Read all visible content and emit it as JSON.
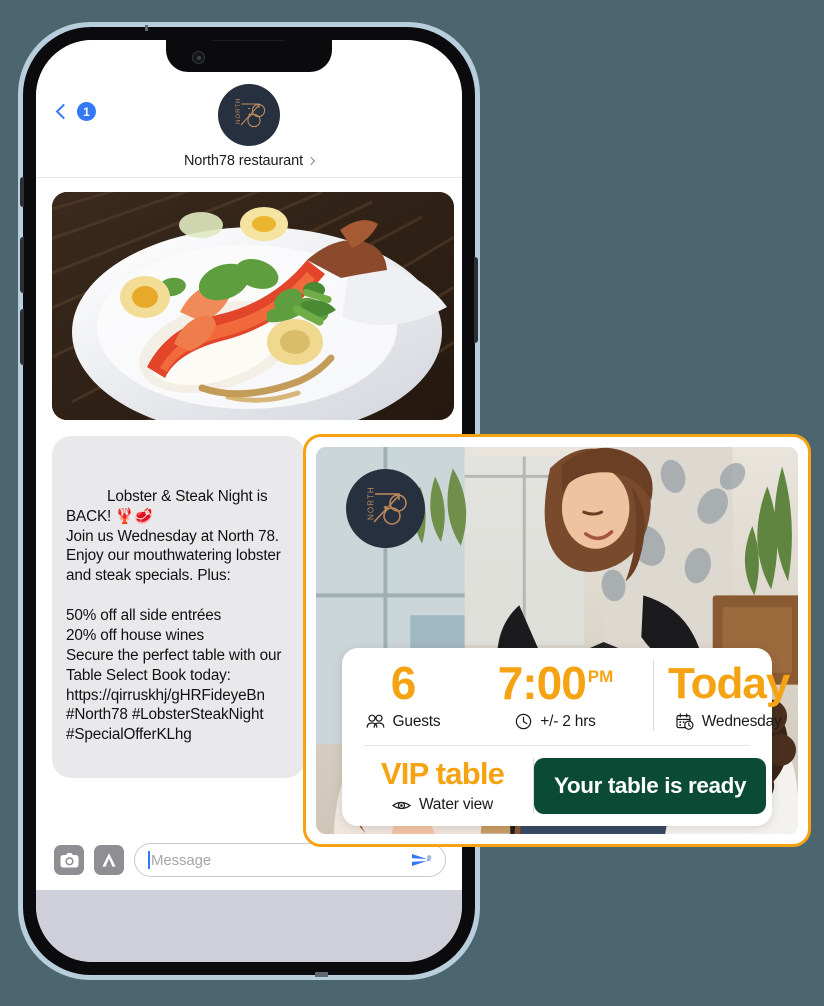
{
  "theme": {
    "background": "#4b666f",
    "accent_orange": "#f5a312",
    "accent_green": "#0b4a35",
    "ios_blue": "#3478f6",
    "logo_navy": "#26303f",
    "logo_copper": "#c08a5e",
    "bubble_grey": "#e9e9eb"
  },
  "phone": {
    "device_name": "smartphone-mockup"
  },
  "header": {
    "back_badge_count": "1",
    "contact_name": "North78 restaurant",
    "avatar_logo_text_vertical": "NORTH",
    "avatar_logo_number": "78"
  },
  "chat": {
    "photo_alt": "lobster-dish-photo",
    "message_text": "Lobster & Steak Night is BACK! 🦞🥩\nJoin us Wednesday at North 78. Enjoy our mouthwatering lobster and steak specials. Plus:\n\n50% off all side entrées\n20% off house wines\nSecure the perfect table with our Table Select Book today: https://qirruskhj/gHRFideyeBn #North78 #LobsterSteakNight #SpecialOfferKLhg"
  },
  "input_bar": {
    "camera_icon": "camera-icon",
    "appstore_icon": "app-store-icon",
    "placeholder": "Message",
    "value": "",
    "send_icon": "send-paperplane-icon"
  },
  "offer_card": {
    "logo_text_vertical": "NORTH",
    "logo_number": "78",
    "photo_alt": "restaurant-server-greeting-guests-photo",
    "details": {
      "guests": {
        "value": "6",
        "label": "Guests",
        "icon": "people-group-icon"
      },
      "time": {
        "value": "7:00",
        "meridiem": "PM",
        "label": "+/- 2 hrs",
        "icon": "clock-icon"
      },
      "date": {
        "value": "Today",
        "label": "Wednesday",
        "icon": "calendar-clock-icon"
      },
      "table": {
        "value": "VIP table",
        "label": "Water view",
        "icon": "eye-icon"
      },
      "cta_label": "Your table is ready"
    }
  }
}
